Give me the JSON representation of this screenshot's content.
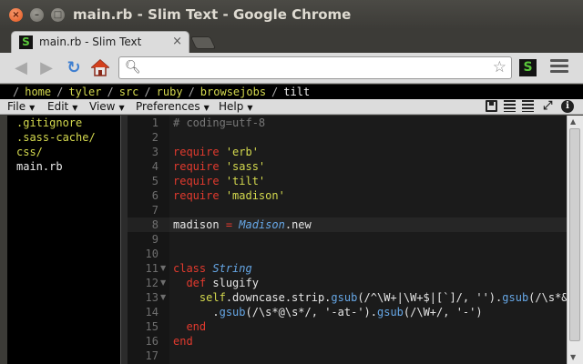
{
  "window": {
    "title": "main.rb - Slim Text - Google Chrome"
  },
  "tab": {
    "title": "main.rb - Slim Text",
    "favicon": "S"
  },
  "omnibox": {
    "value": "",
    "placeholder": ""
  },
  "extension": {
    "label": "S"
  },
  "breadcrumb": {
    "parts": [
      "home",
      "tyler",
      "src",
      "ruby",
      "browsejobs"
    ],
    "current": "tilt",
    "separator": "/"
  },
  "menus": [
    {
      "label": "File"
    },
    {
      "label": "Edit"
    },
    {
      "label": "View"
    },
    {
      "label": "Preferences"
    },
    {
      "label": "Help"
    }
  ],
  "tree": [
    {
      "name": ".gitignore",
      "type": "dir"
    },
    {
      "name": ".sass-cache/",
      "type": "dir"
    },
    {
      "name": "css/",
      "type": "dir"
    },
    {
      "name": "main.rb",
      "type": "file"
    }
  ],
  "code": {
    "line_numbers": [
      "1",
      "2",
      "3",
      "4",
      "5",
      "6",
      "7",
      "8",
      "9",
      "10",
      "11",
      "12",
      "13",
      "14",
      "15",
      "16",
      "17"
    ],
    "l1": "# coding=utf-8",
    "l3_kw": "require",
    "l3_s": "'erb'",
    "l4_kw": "require",
    "l4_s": "'sass'",
    "l5_kw": "require",
    "l5_s": "'tilt'",
    "l6_kw": "require",
    "l6_s": "'madison'",
    "l8_a": "madison",
    "l8_op": "=",
    "l8_cls": "Madison",
    "l8_b": ".new",
    "l11_kw": "class",
    "l11_cls": "String",
    "l12_kw": "def",
    "l12_name": "slugify",
    "l13_a": "self",
    "l13_b": ".downcase.strip.",
    "l13_c": "gsub",
    "l13_d": "(/^\\W+|\\W+$|[`]/, '').",
    "l13_e": "gsub",
    "l13_f": "(/\\s*&\\",
    "l14_a": ".",
    "l14_b": "gsub",
    "l14_c": "(/\\s*@\\s*/, '-at-').",
    "l14_d": "gsub",
    "l14_e": "(/\\W+/, '-')",
    "l15": "end",
    "l16": "end"
  }
}
